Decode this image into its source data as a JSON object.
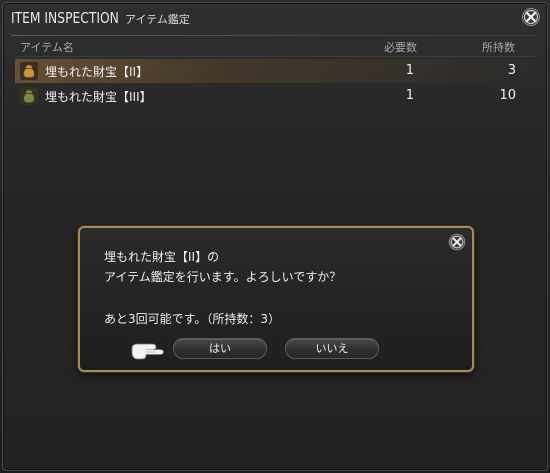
{
  "window": {
    "title_main": "ITEM INSPECTION",
    "title_sub": "アイテム鑑定"
  },
  "table": {
    "headers": {
      "name": "アイテム名",
      "required": "必要数",
      "owned": "所持数"
    },
    "rows": [
      {
        "name": "埋もれた財宝【II】",
        "required": "1",
        "owned": "3",
        "icon": "treasure-pouch-icon",
        "icon_color": "#b58a3c"
      },
      {
        "name": "埋もれた財宝【III】",
        "required": "1",
        "owned": "10",
        "icon": "treasure-pouch-icon",
        "icon_color": "#6d7a3d"
      }
    ]
  },
  "dialog": {
    "line1": "埋もれた財宝【II】の",
    "line2": "アイテム鑑定を行います。よろしいですか？",
    "line3": "あと3回可能です。（所持数：3）",
    "yes_label": "はい",
    "no_label": "いいえ"
  },
  "colors": {
    "accent_border": "#a88a56",
    "selection": "#966e3c"
  }
}
